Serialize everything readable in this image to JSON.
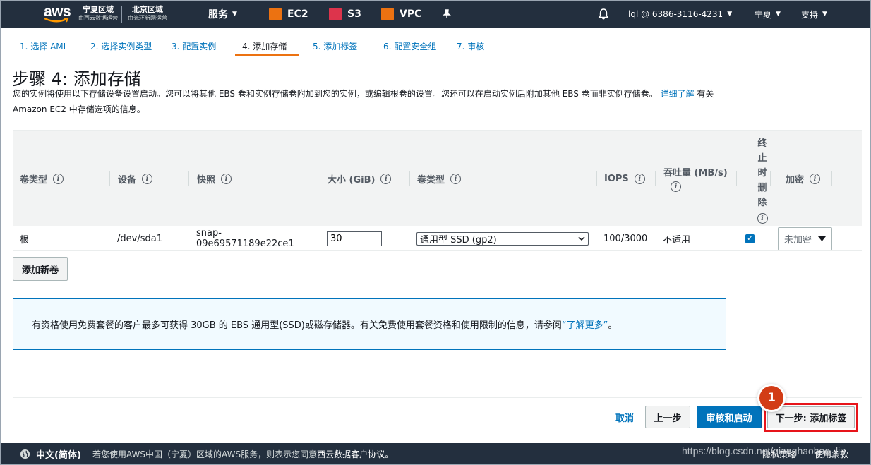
{
  "topnav": {
    "logo_text": "aws",
    "region_ningxia": {
      "title": "宁夏区域",
      "sub": "由西云数据运营"
    },
    "region_beijing": {
      "title": "北京区域",
      "sub": "由光环新网运营"
    },
    "services_label": "服务",
    "shortcuts": [
      {
        "label": "EC2",
        "color": "#ec7211"
      },
      {
        "label": "S3",
        "color": "#dd344c"
      },
      {
        "label": "VPC",
        "color": "#ec7211"
      }
    ],
    "account_label": "lql @ 6386-3116-4231",
    "region_label": "宁夏",
    "support_label": "支持"
  },
  "wizard_tabs": [
    {
      "label": "1. 选择 AMI"
    },
    {
      "label": "2. 选择实例类型"
    },
    {
      "label": "3. 配置实例"
    },
    {
      "label": "4. 添加存储",
      "active": true
    },
    {
      "label": "5. 添加标签"
    },
    {
      "label": "6. 配置安全组"
    },
    {
      "label": "7. 审核"
    }
  ],
  "page": {
    "title": "步骤 4: 添加存储",
    "description": "您的实例将使用以下存储设备设置启动。您可以将其他 EBS 卷和实例存储卷附加到您的实例，或编辑根卷的设置。您还可以在启动实例后附加其他 EBS 卷而非实例存储卷。",
    "learn_more_link": "详细了解",
    "description_tail": "有关 Amazon EC2 中存储选项的信息。"
  },
  "table": {
    "headers": {
      "volume_type": "卷类型",
      "device": "设备",
      "snapshot": "快照",
      "size": "大小 (GiB)",
      "ebs_type": "卷类型",
      "iops": "IOPS",
      "throughput": "吞吐量 (MB/s)",
      "delete_on_termination": [
        "终",
        "止",
        "时",
        "删",
        "除"
      ],
      "encryption": "加密"
    },
    "rows": [
      {
        "volume_type": "根",
        "device": "/dev/sda1",
        "snapshot_line1": "snap-",
        "snapshot_line2": "09e69571189e22ce1",
        "size": "30",
        "ebs_type": "通用型 SSD (gp2)",
        "iops": "100/3000",
        "throughput": "不适用",
        "delete_on_termination": true,
        "encryption": "未加密"
      }
    ],
    "add_volume_button": "添加新卷"
  },
  "info_box": {
    "text": "有资格使用免费套餐的客户最多可获得 30GB 的 EBS 通用型(SSD)或磁存储器。有关免费使用套餐资格和使用限制的信息，请参阅",
    "link": "“了解更多”",
    "tail": "。"
  },
  "footer_actions": {
    "cancel": "取消",
    "previous": "上一步",
    "review_launch": "审核和启动",
    "next": "下一步: 添加标签",
    "annotation_badge": "1"
  },
  "bottombar": {
    "language": "中文(简体)",
    "notice": "若您使用AWS中国（宁夏）区域的AWS服务，则表示您同意",
    "notice_bold": "西云数据客户协议。",
    "privacy": "隐私策略",
    "terms": "使用条款"
  },
  "watermark": "https://blog.csdn.net/qianghaohao_liu"
}
